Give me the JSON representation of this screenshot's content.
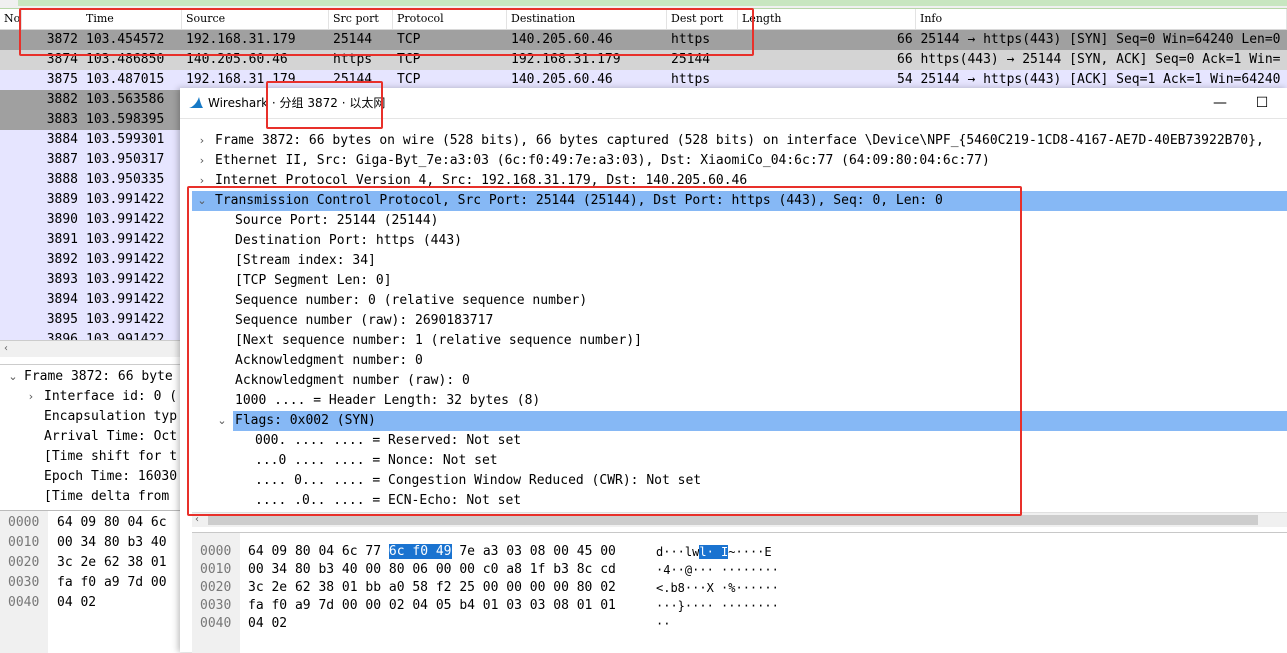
{
  "packet_list": {
    "columns": [
      "No.",
      "Time",
      "Source",
      "Src port",
      "Protocol",
      "Destination",
      "Dest port",
      "Length",
      "Info"
    ],
    "rows": [
      {
        "no": "3872",
        "time": "103.454572",
        "src": "192.168.31.179",
        "sport": "25144",
        "proto": "TCP",
        "dst": "140.205.60.46",
        "dport": "https",
        "len": "",
        "info": "66 25144 → https(443) [SYN] Seq=0 Win=64240 Len=0"
      },
      {
        "no": "3874",
        "time": "103.486850",
        "src": "140.205.60.46",
        "sport": "https",
        "proto": "TCP",
        "dst": "192.168.31.179",
        "dport": "25144",
        "len": "",
        "info": "66 https(443) → 25144 [SYN, ACK] Seq=0 Ack=1 Win="
      },
      {
        "no": "3875",
        "time": "103.487015",
        "src": "192.168.31.179",
        "sport": "25144",
        "proto": "TCP",
        "dst": "140.205.60.46",
        "dport": "https",
        "len": "",
        "info": "54 25144 → https(443) [ACK] Seq=1 Ack=1 Win=64240"
      },
      {
        "no": "3882",
        "time": "103.563586",
        "src": "",
        "sport": "",
        "proto": "",
        "dst": "",
        "dport": "",
        "len": "",
        "info": ""
      },
      {
        "no": "3883",
        "time": "103.598395",
        "src": "",
        "sport": "",
        "proto": "",
        "dst": "",
        "dport": "",
        "len": "",
        "info": ""
      },
      {
        "no": "3884",
        "time": "103.599301",
        "src": "",
        "sport": "",
        "proto": "",
        "dst": "",
        "dport": "",
        "len": "",
        "info": ""
      },
      {
        "no": "3887",
        "time": "103.950317",
        "src": "",
        "sport": "",
        "proto": "",
        "dst": "",
        "dport": "",
        "len": "",
        "info": ""
      },
      {
        "no": "3888",
        "time": "103.950335",
        "src": "",
        "sport": "",
        "proto": "",
        "dst": "",
        "dport": "",
        "len": "",
        "info": ""
      },
      {
        "no": "3889",
        "time": "103.991422",
        "src": "",
        "sport": "",
        "proto": "",
        "dst": "",
        "dport": "",
        "len": "",
        "info": ""
      },
      {
        "no": "3890",
        "time": "103.991422",
        "src": "",
        "sport": "",
        "proto": "",
        "dst": "",
        "dport": "",
        "len": "",
        "info": ""
      },
      {
        "no": "3891",
        "time": "103.991422",
        "src": "",
        "sport": "",
        "proto": "",
        "dst": "",
        "dport": "",
        "len": "",
        "info": ""
      },
      {
        "no": "3892",
        "time": "103.991422",
        "src": "",
        "sport": "",
        "proto": "",
        "dst": "",
        "dport": "",
        "len": "",
        "info": ""
      },
      {
        "no": "3893",
        "time": "103.991422",
        "src": "",
        "sport": "",
        "proto": "",
        "dst": "",
        "dport": "",
        "len": "",
        "info": ""
      },
      {
        "no": "3894",
        "time": "103.991422",
        "src": "",
        "sport": "",
        "proto": "",
        "dst": "",
        "dport": "",
        "len": "",
        "info": ""
      },
      {
        "no": "3895",
        "time": "103.991422",
        "src": "",
        "sport": "",
        "proto": "",
        "dst": "",
        "dport": "",
        "len": "",
        "info": ""
      },
      {
        "no": "3896",
        "time": "103.991422",
        "src": "",
        "sport": "",
        "proto": "",
        "dst": "",
        "dport": "",
        "len": "",
        "info": ""
      }
    ]
  },
  "main_detail": {
    "lines": [
      "Frame 3872: 66 byte",
      "Interface id: 0 (",
      "Encapsulation typ",
      "Arrival Time: Oct",
      "[Time shift for t",
      "Epoch Time: 16030",
      "[Time delta from"
    ]
  },
  "main_hex": {
    "offsets": [
      "0000",
      "0010",
      "0020",
      "0030",
      "0040"
    ],
    "bytes": [
      "64 09 80 04 6c",
      "00 34 80 b3 40",
      "3c 2e 62 38 01",
      "fa f0 a9 7d 00",
      "04 02"
    ]
  },
  "popup": {
    "title_prefix": "Wireshark · ",
    "title_highlight": "分组 3872 · 以太网",
    "minimize": "—",
    "maximize": "☐",
    "tree": [
      {
        "text": "Frame 3872: 66 bytes on wire (528 bits), 66 bytes captured (528 bits) on interface \\Device\\NPF_{5460C219-1CD8-4167-AE7D-40EB73922B70},",
        "arrow": "›",
        "indent": 0
      },
      {
        "text": "Ethernet II, Src: Giga-Byt_7e:a3:03 (6c:f0:49:7e:a3:03), Dst: XiaomiCo_04:6c:77 (64:09:80:04:6c:77)",
        "arrow": "›",
        "indent": 0
      },
      {
        "text": "Internet Protocol Version 4, Src: 192.168.31.179, Dst: 140.205.60.46",
        "arrow": "›",
        "indent": 0
      },
      {
        "text": "Transmission Control Protocol, Src Port: 25144 (25144), Dst Port: https (443), Seq: 0, Len: 0",
        "arrow": "⌄",
        "indent": 0,
        "sel": true
      },
      {
        "text": "Source Port: 25144 (25144)",
        "arrow": "",
        "indent": 1
      },
      {
        "text": "Destination Port: https (443)",
        "arrow": "",
        "indent": 1
      },
      {
        "text": "[Stream index: 34]",
        "arrow": "",
        "indent": 1
      },
      {
        "text": "[TCP Segment Len: 0]",
        "arrow": "",
        "indent": 1
      },
      {
        "text": "Sequence number: 0    (relative sequence number)",
        "arrow": "",
        "indent": 1
      },
      {
        "text": "Sequence number (raw): 2690183717",
        "arrow": "",
        "indent": 1
      },
      {
        "text": "[Next sequence number: 1    (relative sequence number)]",
        "arrow": "",
        "indent": 1
      },
      {
        "text": "Acknowledgment number: 0",
        "arrow": "",
        "indent": 1
      },
      {
        "text": "Acknowledgment number (raw): 0",
        "arrow": "",
        "indent": 1
      },
      {
        "text": "1000 .... = Header Length: 32 bytes (8)",
        "arrow": "",
        "indent": 1
      },
      {
        "text": "Flags: 0x002 (SYN)",
        "arrow": "⌄",
        "indent": 1,
        "sel": true
      },
      {
        "text": "000. .... .... = Reserved: Not set",
        "arrow": "",
        "indent": 2
      },
      {
        "text": "...0 .... .... = Nonce: Not set",
        "arrow": "",
        "indent": 2
      },
      {
        "text": ".... 0... .... = Congestion Window Reduced (CWR): Not set",
        "arrow": "",
        "indent": 2
      },
      {
        "text": ".... .0.. .... = ECN-Echo: Not set",
        "arrow": "",
        "indent": 2
      }
    ],
    "hex": {
      "offsets": [
        "0000",
        "0010",
        "0020",
        "0030",
        "0040"
      ],
      "rows": [
        {
          "pre": "64 09 80 04 6c 77 ",
          "hl": "6c f0  49",
          "post": " 7e a3 03 08 00 45 00",
          "ascii_pre": "d···lw",
          "ascii_hl": "l· I",
          "ascii_post": "~····E"
        },
        {
          "pre": "00 34 80 b3 40 00 80 06  00 00 c0 a8 1f b3 8c cd",
          "hl": "",
          "post": "",
          "ascii_pre": "·4··@···  ········",
          "ascii_hl": "",
          "ascii_post": ""
        },
        {
          "pre": "3c 2e 62 38 01 bb a0 58  f2 25 00 00 00 00 80 02",
          "hl": "",
          "post": "",
          "ascii_pre": "<.b8···X ·%······",
          "ascii_hl": "",
          "ascii_post": ""
        },
        {
          "pre": "fa f0 a9 7d 00 00 02 04  05 b4 01 03 03 08 01 01",
          "hl": "",
          "post": "",
          "ascii_pre": "···}····  ········",
          "ascii_hl": "",
          "ascii_post": ""
        },
        {
          "pre": "04 02",
          "hl": "",
          "post": "",
          "ascii_pre": "··",
          "ascii_hl": "",
          "ascii_post": ""
        }
      ]
    }
  },
  "colors": {
    "annotation": "#e8302a",
    "selected": "#86b8f5",
    "hex_highlight": "#1a73d0",
    "row_tcp": "#e6e5ff",
    "row_selected": "#a0a0a0"
  }
}
